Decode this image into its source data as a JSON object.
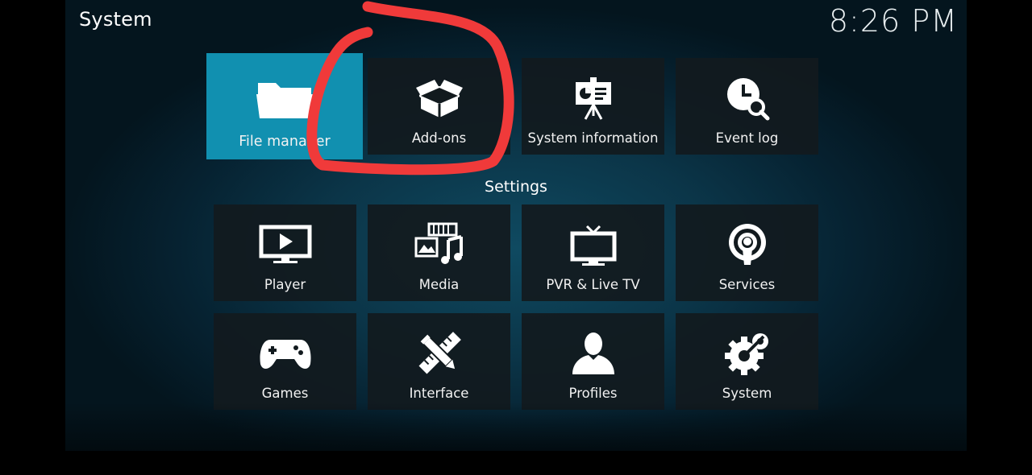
{
  "header": {
    "title": "System",
    "clock": "8:26 PM"
  },
  "top_row": [
    {
      "label": "File manager",
      "icon": "folder-icon",
      "focused": true
    },
    {
      "label": "Add-ons",
      "icon": "box-icon"
    },
    {
      "label": "System information",
      "icon": "presentation-icon"
    },
    {
      "label": "Event log",
      "icon": "clock-search-icon"
    }
  ],
  "settings": {
    "heading": "Settings",
    "items": [
      {
        "label": "Player",
        "icon": "monitor-play-icon"
      },
      {
        "label": "Media",
        "icon": "media-icon"
      },
      {
        "label": "PVR & Live TV",
        "icon": "tv-icon"
      },
      {
        "label": "Services",
        "icon": "podcast-icon"
      },
      {
        "label": "Games",
        "icon": "gamepad-icon"
      },
      {
        "label": "Interface",
        "icon": "pencil-ruler-icon"
      },
      {
        "label": "Profiles",
        "icon": "user-icon"
      },
      {
        "label": "System",
        "icon": "gears-icon"
      }
    ]
  },
  "annotation": {
    "color": "#f03a3a",
    "target": "Add-ons"
  }
}
